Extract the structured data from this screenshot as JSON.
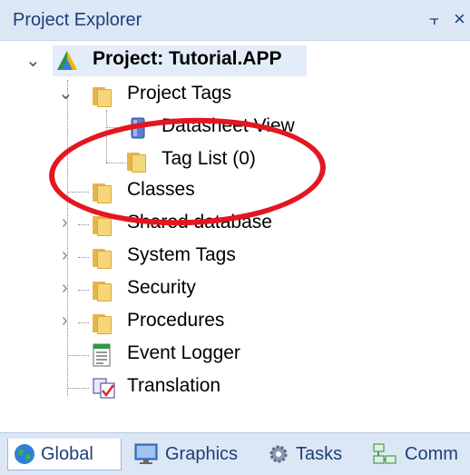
{
  "panel": {
    "title": "Project Explorer",
    "pin_glyph": "⫟",
    "close_glyph": "×"
  },
  "tree": {
    "root": {
      "label": "Project: Tutorial.APP",
      "icon": "app-triangle-icon"
    },
    "items": [
      {
        "label": "Project Tags",
        "icon": "folder-icon",
        "expanded": true
      },
      {
        "label": "Datasheet View",
        "icon": "datasheet-icon"
      },
      {
        "label": "Tag List (0)",
        "icon": "folder-icon"
      },
      {
        "label": "Classes",
        "icon": "folder-icon"
      },
      {
        "label": "Shared database",
        "icon": "folder-icon"
      },
      {
        "label": "System Tags",
        "icon": "folder-icon"
      },
      {
        "label": "Security",
        "icon": "folder-icon"
      },
      {
        "label": "Procedures",
        "icon": "folder-icon"
      },
      {
        "label": "Event Logger",
        "icon": "document-list-icon"
      },
      {
        "label": "Translation",
        "icon": "translation-icon"
      }
    ]
  },
  "tabs": [
    {
      "label": "Global",
      "icon": "globe-icon",
      "active": true
    },
    {
      "label": "Graphics",
      "icon": "monitor-icon"
    },
    {
      "label": "Tasks",
      "icon": "gear-icon"
    },
    {
      "label": "Comm",
      "icon": "network-icon"
    }
  ],
  "colors": {
    "annotation": "#e4161f",
    "titlebar": "#dce7f5",
    "folder": "#f5d67a"
  }
}
